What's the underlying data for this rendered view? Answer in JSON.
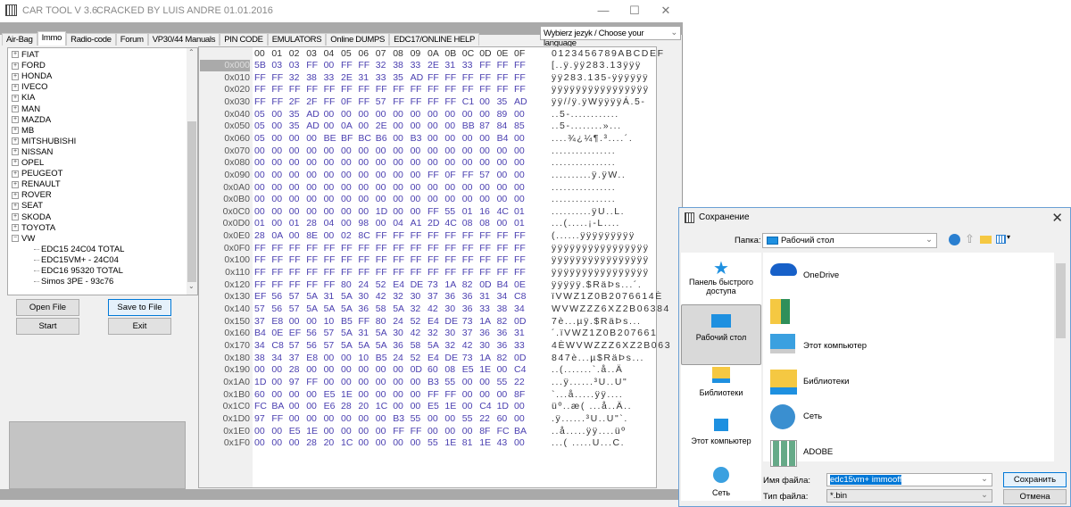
{
  "app": {
    "title": "CAR TOOL V 3.6",
    "subtitle": "CRACKED BY LUIS ANDRE 01.01.2016",
    "minimize": "—",
    "maximize": "☐",
    "close": "✕"
  },
  "tabs": [
    "Air-Bag",
    "Immo",
    "Radio-code",
    "Forum",
    "VP30/44 Manuals",
    "PIN CODE",
    "EMULATORS",
    "Online DUMPS",
    "EDC17/ONLINE HELP"
  ],
  "active_tab": "Immo",
  "language_select": "Wybierz jezyk / Choose your language",
  "tree": {
    "makes": [
      "FIAT",
      "FORD",
      "HONDA",
      "IVECO",
      "KIA",
      "MAN",
      "MAZDA",
      "MB",
      "MITSHUBISHI",
      "NISSAN",
      "OPEL",
      "PEUGEOT",
      "RENAULT",
      "ROVER",
      "SEAT",
      "SKODA",
      "TOYOTA",
      "VW"
    ],
    "expanded": "VW",
    "children": [
      "EDC15 24C04 TOTAL",
      "EDC15VM+ - 24C04",
      "EDC16 95320 TOTAL",
      "Simos 3PE - 93c76"
    ]
  },
  "buttons": {
    "open_file": "Open File",
    "save_to_file": "Save to File",
    "start": "Start",
    "exit": "Exit"
  },
  "hex": {
    "columns": [
      "00",
      "01",
      "02",
      "03",
      "04",
      "05",
      "06",
      "07",
      "08",
      "09",
      "0A",
      "0B",
      "0C",
      "0D",
      "0E",
      "0F"
    ],
    "ascii_header": "0123456789ABCDEF",
    "rows": [
      {
        "o": "0x000",
        "h": "5B 03 03 FF 00 FF FF 32 38 33 2E 31 33 FF FF FF",
        "a": "[..ÿ.ÿÿ283.13ÿÿÿ"
      },
      {
        "o": "0x010",
        "h": "FF FF 32 38 33 2E 31 33 35 AD FF FF FF FF FF FF",
        "a": "ÿÿ283.135-ÿÿÿÿÿÿ"
      },
      {
        "o": "0x020",
        "h": "FF FF FF FF FF FF FF FF FF FF FF FF FF FF FF FF",
        "a": "ÿÿÿÿÿÿÿÿÿÿÿÿÿÿÿÿ"
      },
      {
        "o": "0x030",
        "h": "FF FF 2F 2F FF 0F FF 57 FF FF FF FF C1 00 35 AD",
        "a": "ÿÿ//ÿ.ÿWÿÿÿÿÁ.5-"
      },
      {
        "o": "0x040",
        "h": "05 00 35 AD 00 00 00 00 00 00 00 00 00 00 89 00",
        "a": "..5-............"
      },
      {
        "o": "0x050",
        "h": "05 00 35 AD 00 0A 00 2E 00 00 00 00 BB 87 84 85",
        "a": "..5-........»..."
      },
      {
        "o": "0x060",
        "h": "05 00 00 00 BE BF BC B6 00 B3 00 00 00 00 B4 00",
        "a": "....¾¿¼¶.³....´."
      },
      {
        "o": "0x070",
        "h": "00 00 00 00 00 00 00 00 00 00 00 00 00 00 00 00",
        "a": "................"
      },
      {
        "o": "0x080",
        "h": "00 00 00 00 00 00 00 00 00 00 00 00 00 00 00 00",
        "a": "................"
      },
      {
        "o": "0x090",
        "h": "00 00 00 00 00 00 00 00 00 00 FF 0F FF 57 00 00",
        "a": "..........ÿ.ÿW.."
      },
      {
        "o": "0x0A0",
        "h": "00 00 00 00 00 00 00 00 00 00 00 00 00 00 00 00",
        "a": "................"
      },
      {
        "o": "0x0B0",
        "h": "00 00 00 00 00 00 00 00 00 00 00 00 00 00 00 00",
        "a": "................"
      },
      {
        "o": "0x0C0",
        "h": "00 00 00 00 00 00 00 1D 00 00 FF 55 01 16 4C 01",
        "a": "..........ÿU..L."
      },
      {
        "o": "0x0D0",
        "h": "01 00 01 28 04 00 98 00 04 A1 2D 4C 08 08 00 01",
        "a": "...(.....¡-L...."
      },
      {
        "o": "0x0E0",
        "h": "28 0A 00 8E 00 02 8C FF FF FF FF FF FF FF FF FF",
        "a": "(......ÿÿÿÿÿÿÿÿÿ"
      },
      {
        "o": "0x0F0",
        "h": "FF FF FF FF FF FF FF FF FF FF FF FF FF FF FF FF",
        "a": "ÿÿÿÿÿÿÿÿÿÿÿÿÿÿÿÿ"
      },
      {
        "o": "0x100",
        "h": "FF FF FF FF FF FF FF FF FF FF FF FF FF FF FF FF",
        "a": "ÿÿÿÿÿÿÿÿÿÿÿÿÿÿÿÿ"
      },
      {
        "o": "0x110",
        "h": "FF FF FF FF FF FF FF FF FF FF FF FF FF FF FF FF",
        "a": "ÿÿÿÿÿÿÿÿÿÿÿÿÿÿÿÿ"
      },
      {
        "o": "0x120",
        "h": "FF FF FF FF FF 80 24 52 E4 DE 73 1A 82 0D B4 0E",
        "a": "ÿÿÿÿÿ.$RäÞs...´."
      },
      {
        "o": "0x130",
        "h": "EF 56 57 5A 31 5A 30 42 32 30 37 36 36 31 34 C8",
        "a": "ïVWZ1Z0B2076614È"
      },
      {
        "o": "0x140",
        "h": "57 56 57 5A 5A 5A 36 58 5A 32 42 30 36 33 38 34",
        "a": "WVWZZZ6XZ2B06384"
      },
      {
        "o": "0x150",
        "h": "37 E8 00 00 10 B5 FF 80 24 52 E4 DE 73 1A 82 0D",
        "a": "7è...µÿ.$RäÞs..."
      },
      {
        "o": "0x160",
        "h": "B4 0E EF 56 57 5A 31 5A 30 42 32 30 37 36 36 31",
        "a": "´.ïVWZ1Z0B207661"
      },
      {
        "o": "0x170",
        "h": "34 C8 57 56 57 5A 5A 5A 36 58 5A 32 42 30 36 33",
        "a": "4ÈWVWZZZ6XZ2B063"
      },
      {
        "o": "0x180",
        "h": "38 34 37 E8 00 00 10 B5 24 52 E4 DE 73 1A 82 0D",
        "a": "847è...µ$RäÞs..."
      },
      {
        "o": "0x190",
        "h": "00 00 28 00 00 00 00 00 00 0D 60 08 E5 1E 00 C4",
        "a": "..(.......`.å..Ä"
      },
      {
        "o": "0x1A0",
        "h": "1D 00 97 FF 00 00 00 00 00 00 B3 55 00 00 55 22",
        "a": "...ÿ......³U..U\""
      },
      {
        "o": "0x1B0",
        "h": "60 00 00 00 E5 1E 00 00 00 00 FF FF 00 00 00 8F",
        "a": "`...å.....ÿÿ...."
      },
      {
        "o": "0x1C0",
        "h": "FC BA 00 00 E6 28 20 1C 00 00 E5 1E 00 C4 1D 00",
        "a": "üº..æ( ...å..Ä.."
      },
      {
        "o": "0x1D0",
        "h": "97 FF 00 00 00 00 00 00 B3 55 00 00 55 22 60 00",
        "a": ".ÿ......³U..U\"`."
      },
      {
        "o": "0x1E0",
        "h": "00 00 E5 1E 00 00 00 00 FF FF 00 00 00 8F FC BA",
        "a": "..å.....ÿÿ....üº"
      },
      {
        "o": "0x1F0",
        "h": "00 00 00 28 20 1C 00 00 00 00 55 1E 81 1E 43 00",
        "a": "...( .....U...C."
      }
    ]
  },
  "dialog": {
    "title": "Сохранение",
    "close": "✕",
    "folder_label": "Папка:",
    "folder_value": "Рабочий стол",
    "nav": [
      "Панель быстрого доступа",
      "Рабочий стол",
      "Библиотеки",
      "Этот компьютер",
      "Сеть"
    ],
    "files": [
      "OneDrive",
      "",
      "Этот компьютер",
      "Библиотеки",
      "Сеть",
      "ADOBE"
    ],
    "filename_label": "Имя файла:",
    "filename_value": "edc15vm+ immooff",
    "filetype_label": "Тип файла:",
    "filetype_value": "*.bin",
    "save": "Сохранить",
    "cancel": "Отмена"
  },
  "colors": {
    "hex_byte": "#4a3fb0",
    "dialog_border": "#6a9fd4",
    "selection": "#0078d7"
  }
}
